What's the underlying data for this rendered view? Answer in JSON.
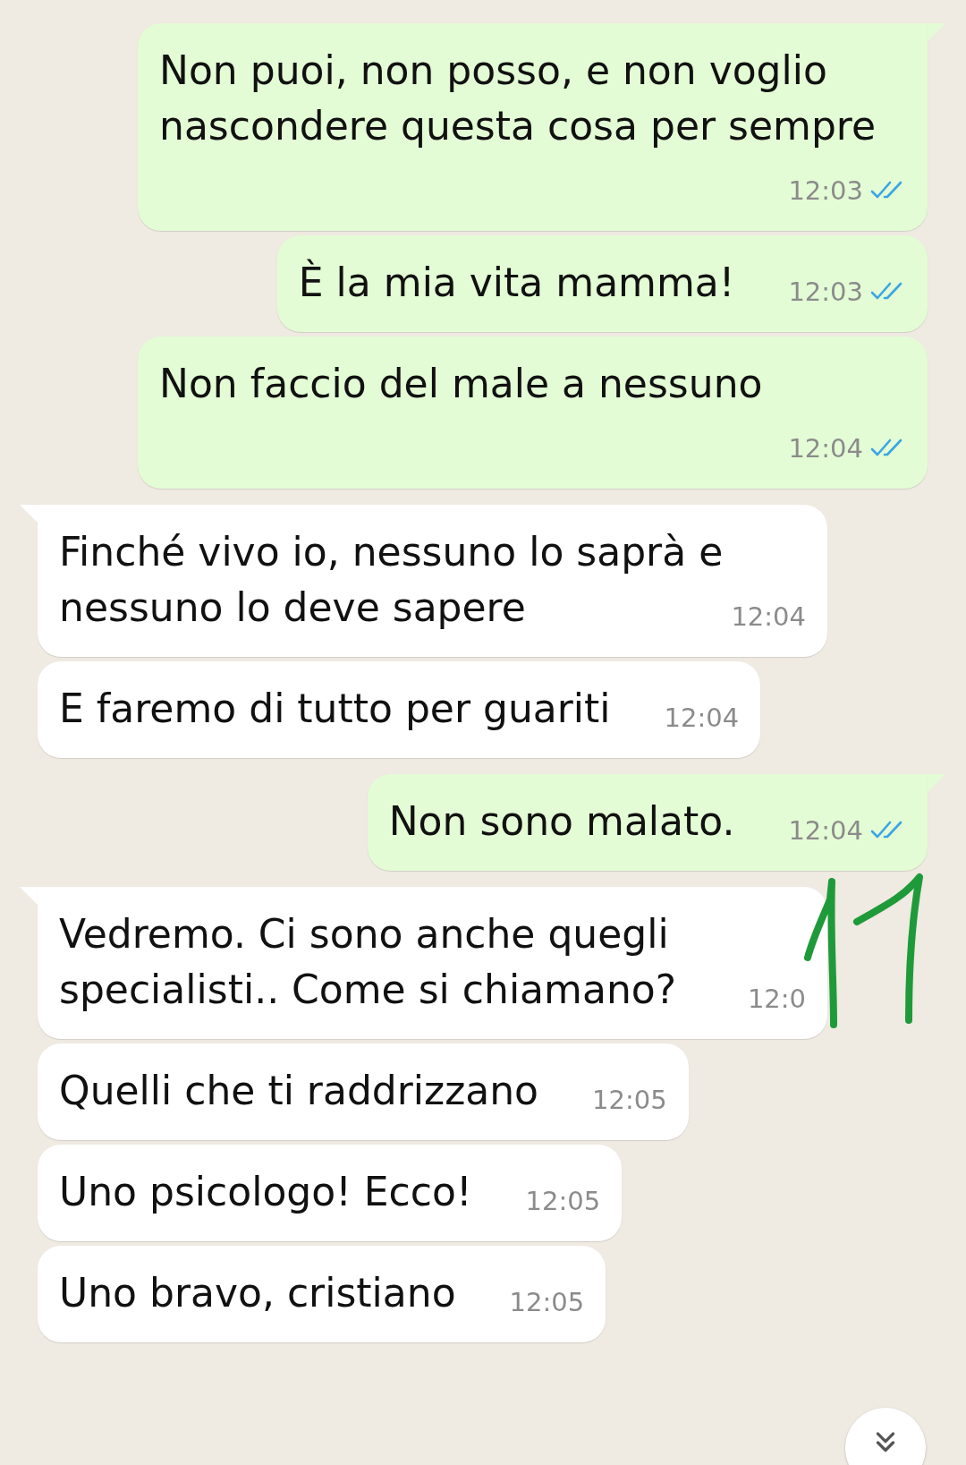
{
  "messages": [
    {
      "kind": "out",
      "text": "Non puoi, non posso, e non voglio nascondere questa cosa per sempre",
      "time": "12:03",
      "read": true,
      "tail": true
    },
    {
      "kind": "out",
      "text": "È la mia vita mamma!",
      "time": "12:03",
      "read": true,
      "tail": false
    },
    {
      "kind": "out",
      "text": "Non faccio del male a nessuno",
      "time": "12:04",
      "read": true,
      "tail": false
    },
    {
      "kind": "in",
      "text": "Finché vivo io, nessuno lo saprà e nessuno lo deve sapere",
      "time": "12:04",
      "tail": true
    },
    {
      "kind": "in",
      "text": "E faremo di tutto per guariti",
      "time": "12:04",
      "tail": false
    },
    {
      "kind": "out",
      "text": "Non sono malato.",
      "time": "12:04",
      "read": true,
      "tail": true
    },
    {
      "kind": "in",
      "text": "Vedremo. Ci sono anche quegli specialisti.. Come si chiamano?",
      "time": "12:0",
      "tail": true
    },
    {
      "kind": "in",
      "text": "Quelli che ti raddrizzano",
      "time": "12:05",
      "tail": false
    },
    {
      "kind": "in",
      "text": "Uno psicologo! Ecco!",
      "time": "12:05",
      "tail": false
    },
    {
      "kind": "in",
      "text": "Uno bravo, cristiano",
      "time": "12:05",
      "tail": false
    }
  ]
}
